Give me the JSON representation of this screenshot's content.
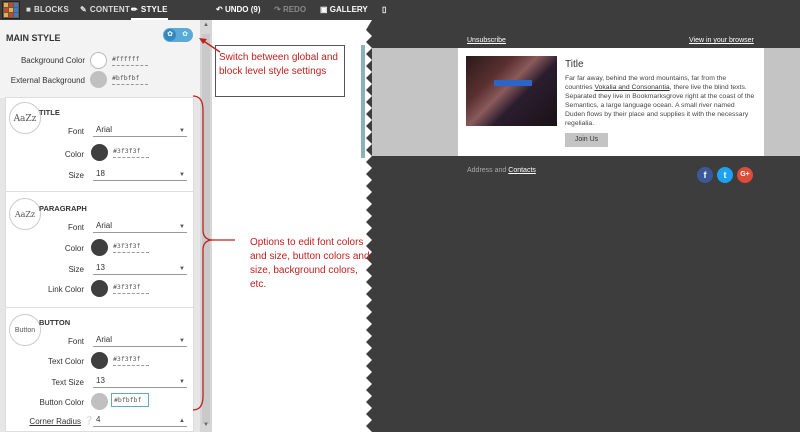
{
  "topbar": {
    "tabs": [
      {
        "label": "BLOCKS",
        "icon": "cubes-icon"
      },
      {
        "label": "CONTENT",
        "icon": "pen-icon"
      },
      {
        "label": "STYLE",
        "icon": "paintbrush-icon",
        "active": true
      }
    ],
    "tools": {
      "undo_label": "UNDO (9)",
      "redo_label": "REDO",
      "gallery_label": "GALLERY"
    }
  },
  "main_style": {
    "title": "MAIN STYLE",
    "background_color_label": "Background Color",
    "background_color_value": "#ffffff",
    "external_background_label": "External Background",
    "external_background_value": "#bfbfbf"
  },
  "title_card": {
    "heading": "TITLE",
    "icon_text": "AaZz",
    "font_label": "Font",
    "font_value": "Arial",
    "color_label": "Color",
    "color_value": "#3f3f3f",
    "size_label": "Size",
    "size_value": "18"
  },
  "paragraph_card": {
    "heading": "PARAGRAPH",
    "icon_text": "AaZz",
    "font_label": "Font",
    "font_value": "Arial",
    "color_label": "Color",
    "color_value": "#3f3f3f",
    "size_label": "Size",
    "size_value": "13",
    "link_color_label": "Link Color",
    "link_color_value": "#3f3f3f"
  },
  "button_card": {
    "heading": "BUTTON",
    "icon_text": "Button",
    "font_label": "Font",
    "font_value": "Arial",
    "text_color_label": "Text Color",
    "text_color_value": "#3f3f3f",
    "text_size_label": "Text Size",
    "text_size_value": "13",
    "button_color_label": "Button Color",
    "button_color_value": "#bfbfbf",
    "corner_radius_label": "Corner Radius",
    "corner_radius_value": "4"
  },
  "email": {
    "unsubscribe": "Unsubscribe",
    "view_in_browser": "View in your browser",
    "title": "Title",
    "body_pre": "Far far away, behind the word mountains, far from the countries ",
    "body_link": "Vokalia and Consonantia",
    "body_post": ", there live the blind texts. Separated they live in Bookmarksgrove right at the coast of the Semantics, a large language ocean. A small river named Duden flows by their place and supplies it with the necessary regelialia.",
    "button": "Join Us",
    "footer_address": "Address and",
    "footer_contacts": "Contacts",
    "social": [
      "facebook-icon",
      "twitter-icon",
      "google-plus-icon"
    ]
  },
  "annotations": {
    "toggle_note": "Switch between global and block level style settings",
    "options_note": "Options to edit font colors and size, button colors and size, background colors, etc."
  },
  "colors": {
    "dark_bar": "#3d3d3d",
    "accent_blue": "#5aa9d6",
    "annotation_red": "#c0211f",
    "swatch_dark": "#3f3f3f",
    "swatch_grey": "#bfbfbf",
    "facebook": "#3b5998",
    "twitter": "#1da1f2",
    "google_plus": "#dd4b39"
  }
}
